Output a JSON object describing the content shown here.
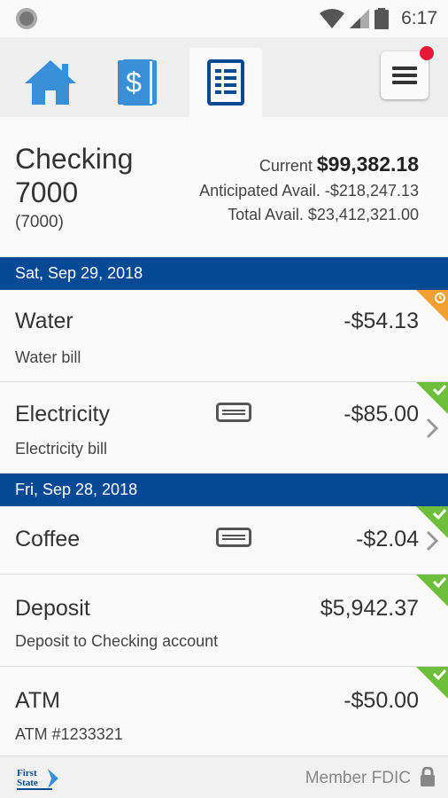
{
  "status_bar": {
    "time": "6:17"
  },
  "tabs": [
    {
      "name": "Home",
      "icon": "home-icon"
    },
    {
      "name": "Transfers",
      "icon": "dollar-icon"
    },
    {
      "name": "Transactions",
      "icon": "document-list-icon",
      "active": true
    }
  ],
  "menu": {
    "icon": "menu-icon",
    "has_notification": true
  },
  "account": {
    "name": "Checking 7000",
    "number": "(7000)",
    "current_label": "Current",
    "current_value": "$99,382.18",
    "anticipated_label": "Anticipated Avail.",
    "anticipated_value": "-$218,247.13",
    "total_label": "Total Avail.",
    "total_value": "$23,412,321.00"
  },
  "groups": [
    {
      "date": "Sat, Sep 29, 2018",
      "transactions": [
        {
          "title": "Water",
          "amount": "-$54.13",
          "description": "Water bill",
          "status": "pending"
        },
        {
          "title": "Electricity",
          "amount": "-$85.00",
          "description": "Electricity bill",
          "status": "cleared",
          "has_memo": true,
          "has_details": true
        }
      ]
    },
    {
      "date": "Fri, Sep 28, 2018",
      "transactions": [
        {
          "title": "Coffee",
          "amount": "-$2.04",
          "description": "",
          "status": "cleared",
          "has_memo": true,
          "has_details": true
        },
        {
          "title": "Deposit",
          "amount": "$5,942.37",
          "description": "Deposit to Checking account",
          "status": "cleared"
        },
        {
          "title": "ATM",
          "amount": "-$50.00",
          "description": "ATM #1233321",
          "status": "cleared"
        }
      ]
    }
  ],
  "footer": {
    "logo_text": "First State",
    "fdic": "Member FDIC"
  },
  "colors": {
    "brand_blue": "#064a96",
    "icon_blue": "#3a8fd9",
    "cleared_green": "#6fbf3c",
    "pending_orange": "#f0a030",
    "notification_red": "#e8173a"
  }
}
